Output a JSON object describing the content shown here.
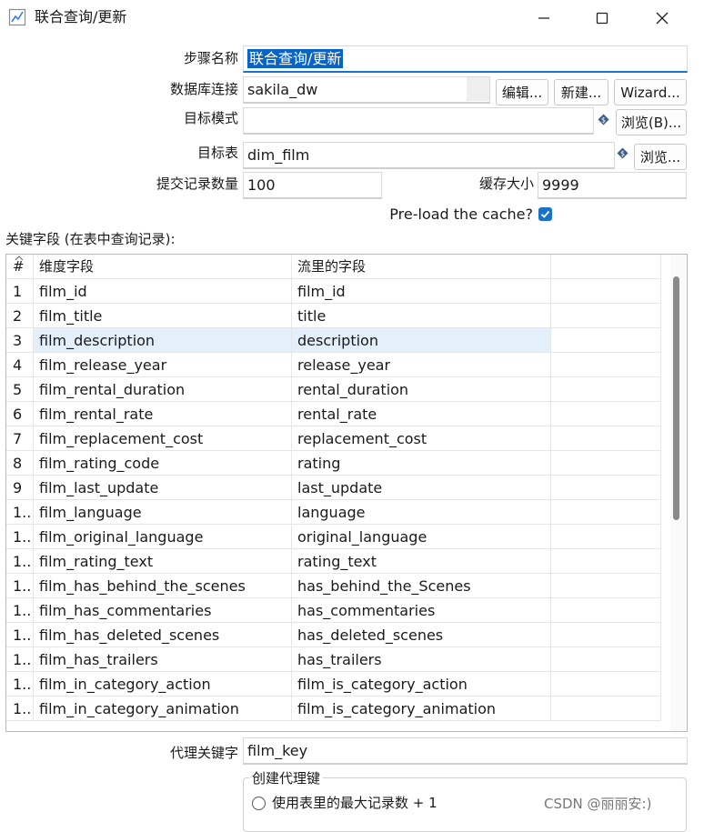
{
  "window": {
    "title": "联合查询/更新",
    "minimize_icon": "minimize-icon",
    "maximize_icon": "maximize-icon",
    "close_icon": "close-icon"
  },
  "form": {
    "step_name_label": "步骤名称",
    "step_name_value": "联合查询/更新",
    "db_conn_label": "数据库连接",
    "db_conn_value": "sakila_dw",
    "edit_button": "编辑...",
    "new_button": "新建...",
    "wizard_button": "Wizard...",
    "target_schema_label": "目标模式",
    "target_schema_value": "",
    "browse_b_button": "浏览(B)...",
    "target_table_label": "目标表",
    "target_table_value": "dim_film",
    "browse_button": "浏览...",
    "commit_size_label": "提交记录数量",
    "commit_size_value": "100",
    "cache_size_label": "缓存大小",
    "cache_size_value": "9999",
    "preload_label": "Pre-load the cache?",
    "preload_checked": true,
    "keys_section_label": "关键字段 (在表中查询记录):"
  },
  "table": {
    "columns": [
      "#",
      "维度字段",
      "流里的字段",
      ""
    ],
    "selected_row": 2,
    "rows": [
      [
        "1",
        "film_id",
        "film_id"
      ],
      [
        "2",
        "film_title",
        "title"
      ],
      [
        "3",
        "film_description",
        "description"
      ],
      [
        "4",
        "film_release_year",
        "release_year"
      ],
      [
        "5",
        "film_rental_duration",
        "rental_duration"
      ],
      [
        "6",
        "film_rental_rate",
        "rental_rate"
      ],
      [
        "7",
        "film_replacement_cost",
        "replacement_cost"
      ],
      [
        "8",
        "film_rating_code",
        "rating"
      ],
      [
        "9",
        "film_last_update",
        "last_update"
      ],
      [
        "1..",
        "film_language",
        "language"
      ],
      [
        "1..",
        "film_original_language",
        "original_language"
      ],
      [
        "1..",
        "film_rating_text",
        "rating_text"
      ],
      [
        "1..",
        "film_has_behind_the_scenes",
        "has_behind_the_Scenes"
      ],
      [
        "1..",
        "film_has_commentaries",
        "has_commentaries"
      ],
      [
        "1..",
        "film_has_deleted_scenes",
        "has_deleted_scenes"
      ],
      [
        "1..",
        "film_has_trailers",
        "has_trailers"
      ],
      [
        "1..",
        "film_in_category_action",
        "film_is_category_action"
      ],
      [
        "1..",
        "film_in_category_animation",
        "film_is_category_animation"
      ]
    ]
  },
  "surrogate": {
    "label": "代理关键字",
    "value": "film_key",
    "group_label": "创建代理键",
    "radio_max_label": "使用表里的最大记录数 + 1"
  },
  "watermark": "CSDN @丽丽安:)",
  "colors": {
    "accent": "#1a73c9",
    "selection": "#e3effa",
    "text_selection": "#0a64c8"
  }
}
